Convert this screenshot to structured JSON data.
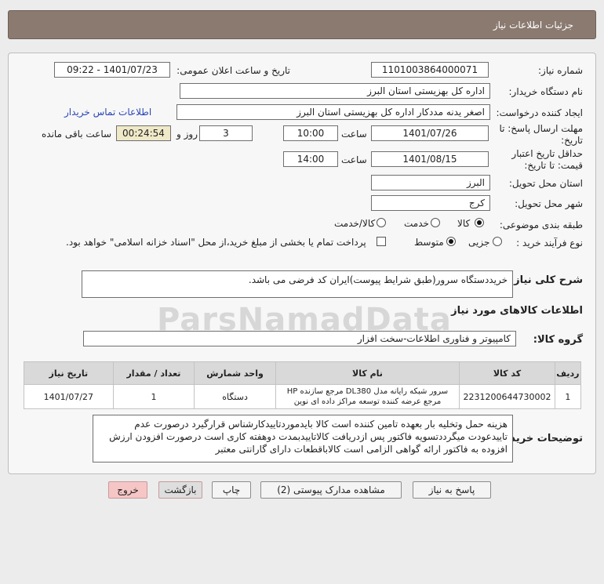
{
  "header": {
    "title": "جزئیات اطلاعات نیاز"
  },
  "form": {
    "need_number": {
      "label": "شماره نیاز:",
      "value": "1101003864000071"
    },
    "announce": {
      "label": "تاریخ و ساعت اعلان عمومی:",
      "value": "1401/07/23 - 09:22"
    },
    "buyer_org": {
      "label": "نام دستگاه خریدار:",
      "value": "اداره کل بهزیستی استان البرز"
    },
    "creator": {
      "label": "ایجاد کننده درخواست:",
      "value": "اصغر یدنه مددکار اداره کل بهزیستی استان البرز",
      "contact_link": "اطلاعات تماس خریدار"
    },
    "deadline": {
      "label": "مهلت ارسال پاسخ: تا تاریخ:",
      "date": "1401/07/26",
      "time_label": "ساعت",
      "time": "10:00",
      "days": "3",
      "days_label": "روز و",
      "remaining": "00:24:54",
      "remaining_label": "ساعت باقی مانده"
    },
    "validity": {
      "label": "حداقل تاریخ اعتبار قیمت: تا تاریخ:",
      "date": "1401/08/15",
      "time_label": "ساعت",
      "time": "14:00"
    },
    "province": {
      "label": "استان محل تحویل:",
      "value": "البرز"
    },
    "city": {
      "label": "شهر محل تحویل:",
      "value": "کرج"
    },
    "category": {
      "label": "طبقه بندی موضوعی:",
      "opt1": "کالا",
      "opt2": "خدمت",
      "opt3": "کالا/خدمت"
    },
    "process": {
      "label": "نوع فرآیند خرید :",
      "opt1": "جزیی",
      "opt2": "متوسط",
      "note": "پرداخت تمام یا بخشی از مبلغ خرید،از محل \"اسناد خزانه اسلامی\" خواهد بود."
    }
  },
  "description": {
    "label": "شرح کلی نیاز:",
    "value": "خریددستگاه سرور(طبق شرایط پیوست)ایران کد فرضی می باشد."
  },
  "goods_section": {
    "title": "اطلاعات کالاهای مورد نیاز",
    "group_label": "گروه کالا:",
    "group_value": "کامپیوتر و فناوری اطلاعات-سخت افزار"
  },
  "table": {
    "headers": [
      "ردیف",
      "کد کالا",
      "نام کالا",
      "واحد شمارش",
      "تعداد / مقدار",
      "تاریخ نیاز"
    ],
    "rows": [
      {
        "row": "1",
        "code": "2231200644730002",
        "name": "سرور شبکه رایانه مدل DL380 مرجع سازنده HP مرجع عرضه کننده توسعه مراکز داده ای نوین",
        "unit": "دستگاه",
        "qty": "1",
        "date": "1401/07/27"
      }
    ]
  },
  "notes": {
    "label": "توضیحات خریدار:",
    "value": "هزینه حمل وتخلیه بار بعهده تامین کننده است کالا بایدموردتاییدکارشناس قرارگیرد درصورت عدم تاییدعودت میگرددتسویه فاکتور پس ازدریافت کالاتاییدبمدت دوهفته کاری است درصورت افزودن ارزش افزوده به فاکتور ارائه گواهی الزامی است کالاباقطعات دارای گارانتی معتبر"
  },
  "buttons": {
    "reply": "پاسخ به نیاز",
    "attachments": "مشاهده مدارک پیوستی (2)",
    "print": "چاپ",
    "back": "بازگشت",
    "exit": "خروج"
  },
  "watermark": "ParsNamadData"
}
